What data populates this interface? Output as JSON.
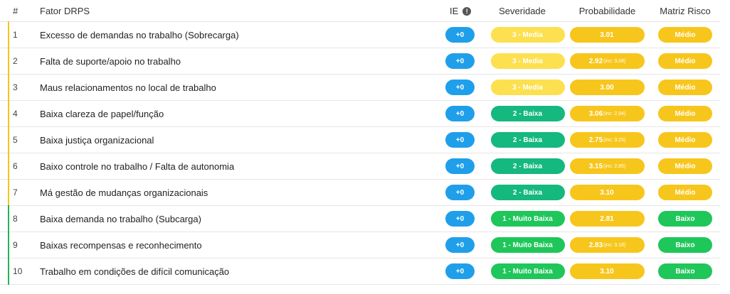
{
  "header": {
    "num": "#",
    "factor": "Fator DRPS",
    "ie": "IE",
    "ie_info_icon": "!",
    "severity": "Severidade",
    "probability": "Probabilidade",
    "risk_matrix": "Matriz Risco"
  },
  "colors": {
    "ie_blue": "#1f9fea",
    "sev_media": "#fce04f",
    "sev_baixa": "#15b87f",
    "sev_muito_baixa": "#1fc65a",
    "prob_yellow": "#f7c61c",
    "mat_medio": "#f7c61c",
    "mat_baixo": "#1fc65a",
    "bar_yellow": "#f5c518",
    "bar_green": "#22b455"
  },
  "rows": [
    {
      "num": "1",
      "factor": "Excesso de demandas no trabalho (Sobrecarga)",
      "ie": "+0",
      "severity": "3 - Media",
      "probability": "3.01",
      "prob_inc": "",
      "matrix": "Médio"
    },
    {
      "num": "2",
      "factor": "Falta de suporte/apoio no trabalho",
      "ie": "+0",
      "severity": "3 - Media",
      "probability": "2.92",
      "prob_inc": "(inc: 3.08)",
      "matrix": "Médio"
    },
    {
      "num": "3",
      "factor": "Maus relacionamentos no local de trabalho",
      "ie": "+0",
      "severity": "3 - Media",
      "probability": "3.00",
      "prob_inc": "",
      "matrix": "Médio"
    },
    {
      "num": "4",
      "factor": "Baixa clareza de papel/função",
      "ie": "+0",
      "severity": "2 - Baixa",
      "probability": "3.06",
      "prob_inc": "(inc: 2.94)",
      "matrix": "Médio"
    },
    {
      "num": "5",
      "factor": "Baixa justiça organizacional",
      "ie": "+0",
      "severity": "2 - Baixa",
      "probability": "2.75",
      "prob_inc": "(inc: 3.25)",
      "matrix": "Médio"
    },
    {
      "num": "6",
      "factor": "Baixo controle no trabalho / Falta de autonomia",
      "ie": "+0",
      "severity": "2 - Baixa",
      "probability": "3.15",
      "prob_inc": "(inc: 2.85)",
      "matrix": "Médio"
    },
    {
      "num": "7",
      "factor": "Má gestão de mudanças organizacionais",
      "ie": "+0",
      "severity": "2 - Baixa",
      "probability": "3.10",
      "prob_inc": "",
      "matrix": "Médio"
    },
    {
      "num": "8",
      "factor": "Baixa demanda no trabalho (Subcarga)",
      "ie": "+0",
      "severity": "1 - Muito Baixa",
      "probability": "2.81",
      "prob_inc": "",
      "matrix": "Baixo"
    },
    {
      "num": "9",
      "factor": "Baixas recompensas e reconhecimento",
      "ie": "+0",
      "severity": "1 - Muito Baixa",
      "probability": "2.83",
      "prob_inc": "(inc: 3.18)",
      "matrix": "Baixo"
    },
    {
      "num": "10",
      "factor": "Trabalho em condições de difícil comunicação",
      "ie": "+0",
      "severity": "1 - Muito Baixa",
      "probability": "3.10",
      "prob_inc": "",
      "matrix": "Baixo"
    }
  ]
}
